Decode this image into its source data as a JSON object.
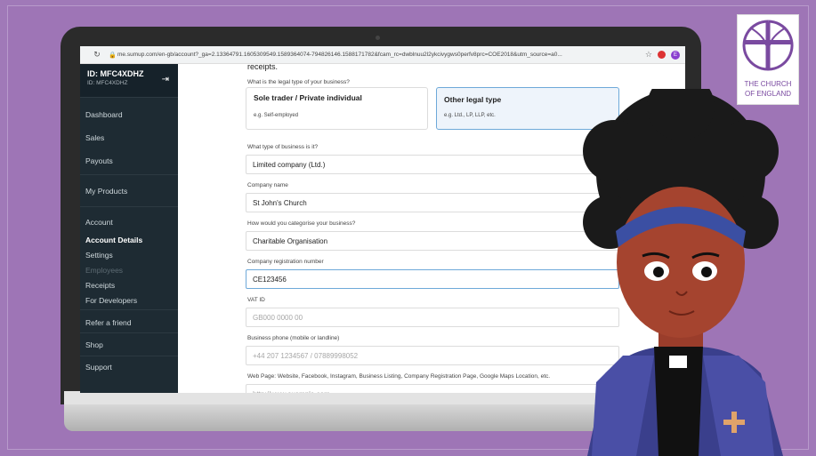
{
  "browser": {
    "url": "me.sumup.com/en-gb/account?_ga=2.13364791.1605309549.1589364074-794826146.1588171782&fcam_rc=dwblnuu2l2ykcivygws0perfv8prc=COE2018&utm_source=a0...",
    "ext_letter": "E"
  },
  "sidebar": {
    "id_label": "ID: MFC4XDHZ",
    "id_sub": "ID: MFC4XDHZ",
    "items": [
      {
        "label": "Dashboard"
      },
      {
        "label": "Sales"
      },
      {
        "label": "Payouts"
      },
      {
        "label": "My Products"
      },
      {
        "label": "Account"
      },
      {
        "label": "Account Details"
      },
      {
        "label": "Settings"
      },
      {
        "label": "Employees"
      },
      {
        "label": "Receipts"
      },
      {
        "label": "For Developers"
      },
      {
        "label": "Refer a friend"
      },
      {
        "label": "Shop"
      },
      {
        "label": "Support"
      }
    ]
  },
  "form": {
    "receipts_text": "receipts.",
    "legal_type_label": "What is the legal type of your business?",
    "option1_title": "Sole trader / Private individual",
    "option1_sub": "e.g. Self-employed",
    "option2_title": "Other legal type",
    "option2_sub": "e.g. Ltd., LP, LLP, etc.",
    "business_type_label": "What type of business is it?",
    "business_type_value": "Limited company (Ltd.)",
    "company_name_label": "Company name",
    "company_name_value": "St John's Church",
    "category_label": "How would you categorise your business?",
    "category_value": "Charitable Organisation",
    "reg_number_label": "Company registration number",
    "reg_number_value": "CE123456",
    "vat_label": "VAT ID",
    "vat_placeholder": "GB000 0000 00",
    "phone_label": "Business phone (mobile or landline)",
    "phone_placeholder": "+44 207 1234567 / 07889998052",
    "web_label": "Web Page: Website, Facebook, Instagram, Business Listing, Company Registration Page, Google Maps Location, etc.",
    "web_placeholder": "http://www.example.com"
  },
  "logo": {
    "line1": "THE CHURCH",
    "line2": "OF ENGLAND"
  }
}
